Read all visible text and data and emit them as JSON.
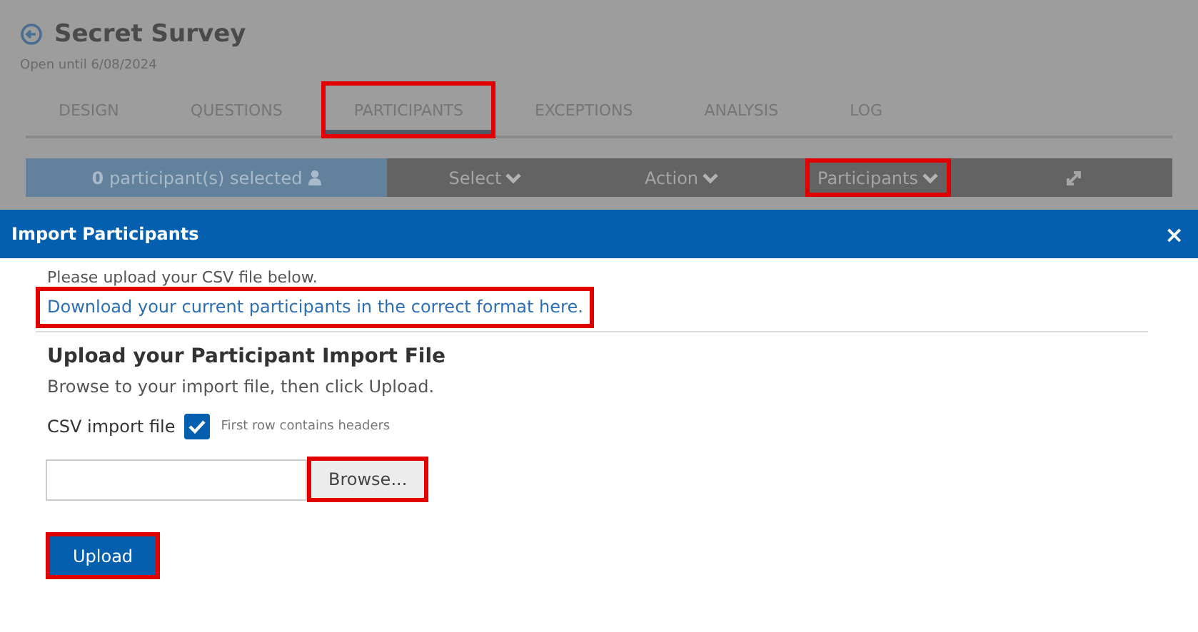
{
  "page": {
    "title": "Secret Survey",
    "subtitle": "Open until 6/08/2024",
    "tabs": [
      {
        "label": "DESIGN",
        "selected": false,
        "highlighted": false
      },
      {
        "label": "QUESTIONS",
        "selected": false,
        "highlighted": false
      },
      {
        "label": "PARTICIPANTS",
        "selected": true,
        "highlighted": true
      },
      {
        "label": "EXCEPTIONS",
        "selected": false,
        "highlighted": false
      },
      {
        "label": "ANALYSIS",
        "selected": false,
        "highlighted": false
      },
      {
        "label": "LOG",
        "selected": false,
        "highlighted": false
      }
    ],
    "toolbar": {
      "count": "0",
      "count_text": "participant(s) selected",
      "menus": [
        {
          "label": "Select",
          "highlighted": false
        },
        {
          "label": "Action",
          "highlighted": false
        },
        {
          "label": "Participants",
          "highlighted": true
        }
      ]
    }
  },
  "dialog": {
    "title": "Import Participants",
    "close": "×",
    "intro": "Please upload your CSV file below.",
    "link": {
      "text": "Download your current participants in the correct format here.",
      "highlighted": true
    },
    "heading": "Upload your Participant Import File",
    "instructions": "Browse to your import file, then click Upload.",
    "file_label": "CSV import file",
    "headers_checkbox": {
      "label": "First row contains headers",
      "checked": true
    },
    "browse_button": {
      "label": "Browse...",
      "highlighted": true
    },
    "upload_button": {
      "label": "Upload",
      "highlighted": true
    }
  }
}
